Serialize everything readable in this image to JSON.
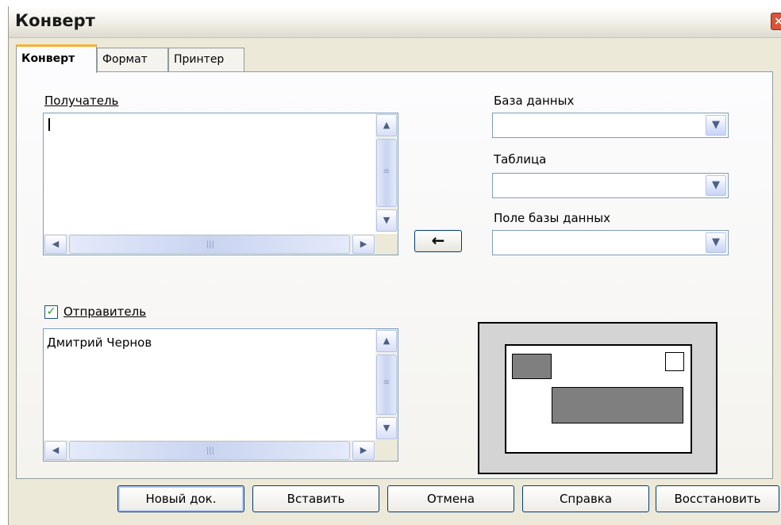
{
  "window": {
    "title": "Конверт"
  },
  "tabs": [
    {
      "label": "Конверт",
      "active": true
    },
    {
      "label": "Формат",
      "active": false
    },
    {
      "label": "Принтер",
      "active": false
    }
  ],
  "recipient": {
    "label": "Получатель",
    "value": ""
  },
  "sender": {
    "label": "Отправитель",
    "checked": true,
    "value": "Дмитрий Чернов"
  },
  "database": {
    "label": "База данных",
    "value": ""
  },
  "table": {
    "label": "Таблица",
    "value": ""
  },
  "db_field": {
    "label": "Поле базы данных",
    "value": ""
  },
  "insert_field_arrow": "←",
  "icons": {
    "scroll_up": "▲",
    "scroll_down": "▼",
    "scroll_left": "◀",
    "scroll_right": "▶",
    "dropdown": "▼",
    "check": "✓",
    "close": "×"
  },
  "buttons": {
    "new_doc": "Новый док.",
    "insert": "Вставить",
    "cancel": "Отмена",
    "help": "Справка",
    "reset": "Восстановить"
  }
}
